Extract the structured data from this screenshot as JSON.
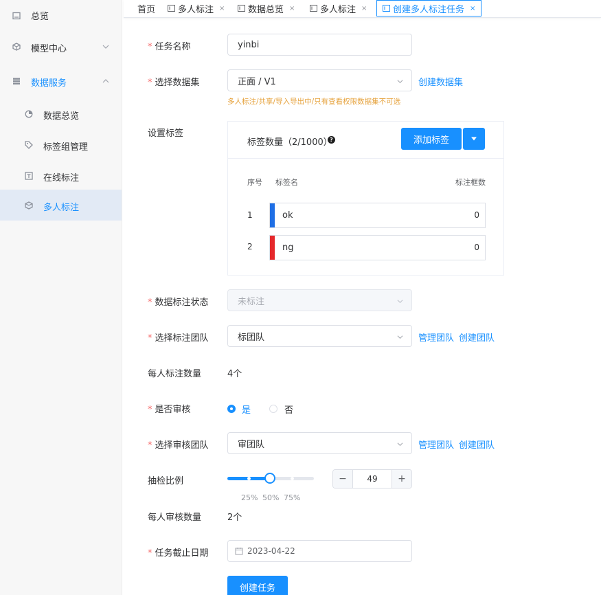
{
  "sidebar": {
    "items": [
      {
        "label": "总览",
        "icon": "dashboard-icon"
      },
      {
        "label": "模型中心",
        "icon": "cube-icon"
      },
      {
        "label": "数据服务",
        "icon": "database-icon"
      },
      {
        "label": "数据总览",
        "icon": "pie-chart-icon"
      },
      {
        "label": "标签组管理",
        "icon": "tag-icon"
      },
      {
        "label": "在线标注",
        "icon": "text-box-icon"
      },
      {
        "label": "多人标注",
        "icon": "cube-icon"
      }
    ]
  },
  "tabs": [
    {
      "label": "首页"
    },
    {
      "label": "多人标注",
      "close": "×"
    },
    {
      "label": "数据总览",
      "close": "×"
    },
    {
      "label": "多人标注",
      "close": "×"
    },
    {
      "label": "创建多人标注任务",
      "close": "×"
    }
  ],
  "form": {
    "task_name": {
      "label": "任务名称",
      "value": "yinbi"
    },
    "dataset": {
      "label": "选择数据集",
      "value": "正面 / V1",
      "link": "创建数据集",
      "hint": "多人标注/共享/导入导出中/只有查看权限数据集不可选"
    },
    "tags": {
      "label": "设置标签",
      "count_label": "标签数量（2/1000）",
      "help": "?",
      "add_button": "添加标签",
      "columns": [
        "序号",
        "标签名",
        "标注框数"
      ],
      "rows": [
        {
          "index": "1",
          "name": "ok",
          "count": "0",
          "color": "#1f6fe5"
        },
        {
          "index": "2",
          "name": "ng",
          "count": "0",
          "color": "#e5282b"
        }
      ]
    },
    "status": {
      "label": "数据标注状态",
      "value": "未标注"
    },
    "label_team": {
      "label": "选择标注团队",
      "value": "标团队",
      "link_manage": "管理团队",
      "link_create": "创建团队"
    },
    "per_person": {
      "label": "每人标注数量",
      "value": "4个"
    },
    "review": {
      "label": "是否审核",
      "yes": "是",
      "no": "否"
    },
    "review_team": {
      "label": "选择审核团队",
      "value": "审团队",
      "link_manage": "管理团队",
      "link_create": "创建团队"
    },
    "sample_ratio": {
      "label": "抽检比例",
      "value": "49",
      "fraction": 0.49,
      "marks": [
        "25%",
        "50%",
        "75%"
      ],
      "minus": "−",
      "plus": "+"
    },
    "per_review": {
      "label": "每人审核数量",
      "value": "2个"
    },
    "deadline": {
      "label": "任务截止日期",
      "value": "2023-04-22"
    },
    "submit": "创建任务"
  },
  "colors": {
    "accent": "#1890ff",
    "required": "#f56c6c",
    "warning": "#e6a23c"
  }
}
